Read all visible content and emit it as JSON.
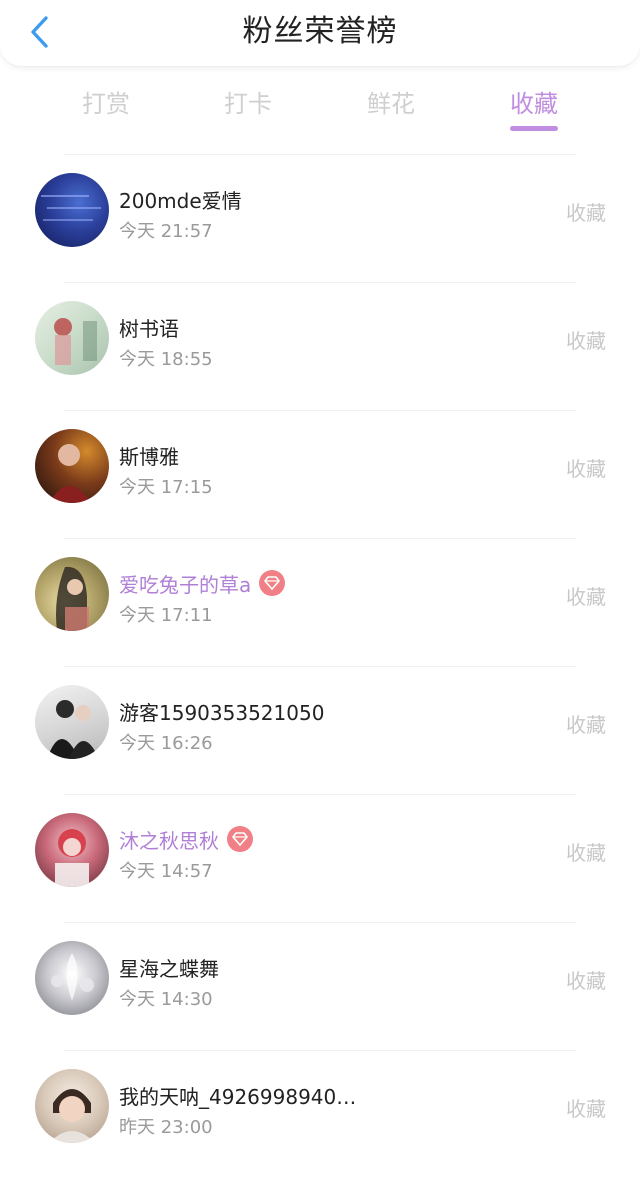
{
  "header": {
    "title": "粉丝荣誉榜",
    "back_icon": "chevron-left-icon"
  },
  "colors": {
    "accent": "#c08ee0",
    "vip_name": "#b07fd6",
    "gem_badge": "#f07f86",
    "back_arrow": "#3d9bf0",
    "muted_text": "#9a9a9a",
    "inactive_tab": "#cfcfcf"
  },
  "tabs": [
    {
      "label": "打赏",
      "active": false
    },
    {
      "label": "打卡",
      "active": false
    },
    {
      "label": "鲜花",
      "active": false
    },
    {
      "label": "收藏",
      "active": true
    }
  ],
  "list": [
    {
      "name": "200mde爱情",
      "time": "今天 21:57",
      "action": "收藏",
      "vip": false
    },
    {
      "name": "树书语",
      "time": "今天 18:55",
      "action": "收藏",
      "vip": false
    },
    {
      "name": "斯博雅",
      "time": "今天 17:15",
      "action": "收藏",
      "vip": false
    },
    {
      "name": "爱吃兔子的草a",
      "time": "今天 17:11",
      "action": "收藏",
      "vip": true
    },
    {
      "name": "游客1590353521050",
      "time": "今天 16:26",
      "action": "收藏",
      "vip": false
    },
    {
      "name": "沐之秋思秋",
      "time": "今天 14:57",
      "action": "收藏",
      "vip": true
    },
    {
      "name": "星海之蝶舞",
      "time": "今天 14:30",
      "action": "收藏",
      "vip": false
    },
    {
      "name": "我的天呐_4926998940…",
      "time": "昨天 23:00",
      "action": "收藏",
      "vip": false
    }
  ]
}
